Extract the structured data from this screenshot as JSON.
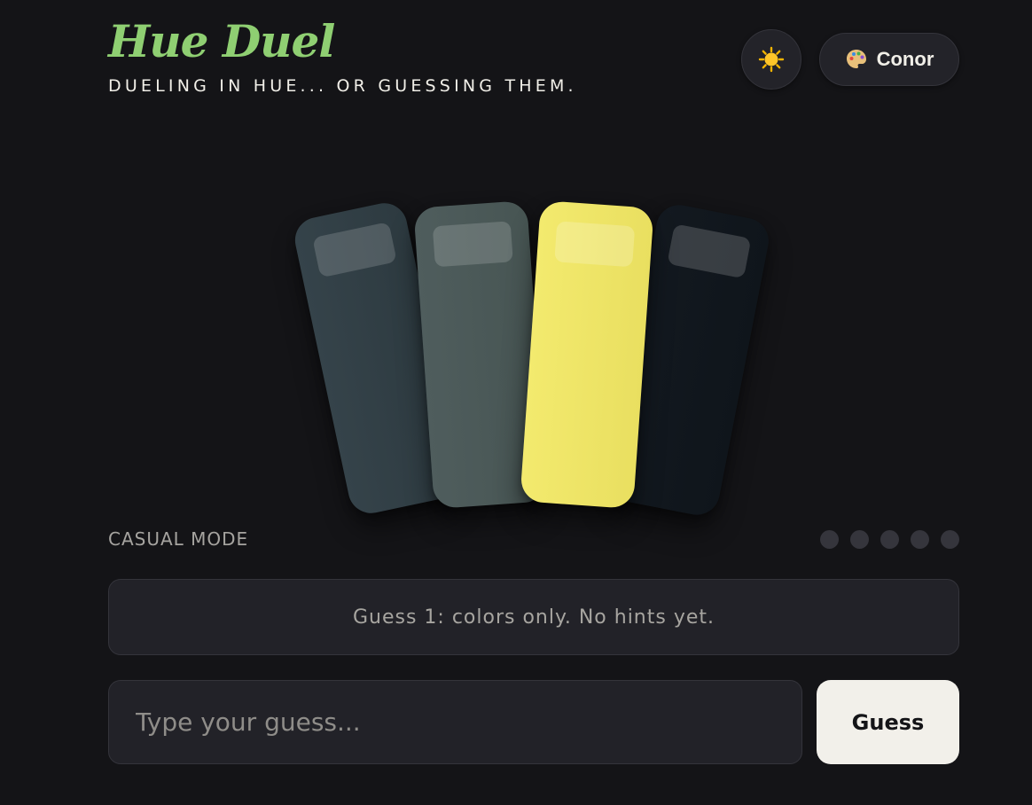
{
  "header": {
    "title": "Hue Duel",
    "subtitle": "DUELING IN HUE... OR GUESSING THEM.",
    "theme_toggle_icon": "sun-icon",
    "user": {
      "icon": "palette-icon",
      "name": "Conor"
    }
  },
  "swatches": [
    {
      "color": "#323f46"
    },
    {
      "color": "#4c5958"
    },
    {
      "color": "#efe567"
    },
    {
      "color": "#11171e"
    }
  ],
  "mode": {
    "label": "CASUAL MODE"
  },
  "progress": {
    "total_guesses": 5,
    "used_guesses": 0
  },
  "hint": {
    "text": "Guess 1: colors only. No hints yet."
  },
  "guess_form": {
    "placeholder": "Type your guess...",
    "value": "",
    "button_label": "Guess"
  },
  "colors": {
    "background": "#141417",
    "accent": "#8fcf72",
    "panel": "#222228",
    "button": "#f2f0ea"
  }
}
